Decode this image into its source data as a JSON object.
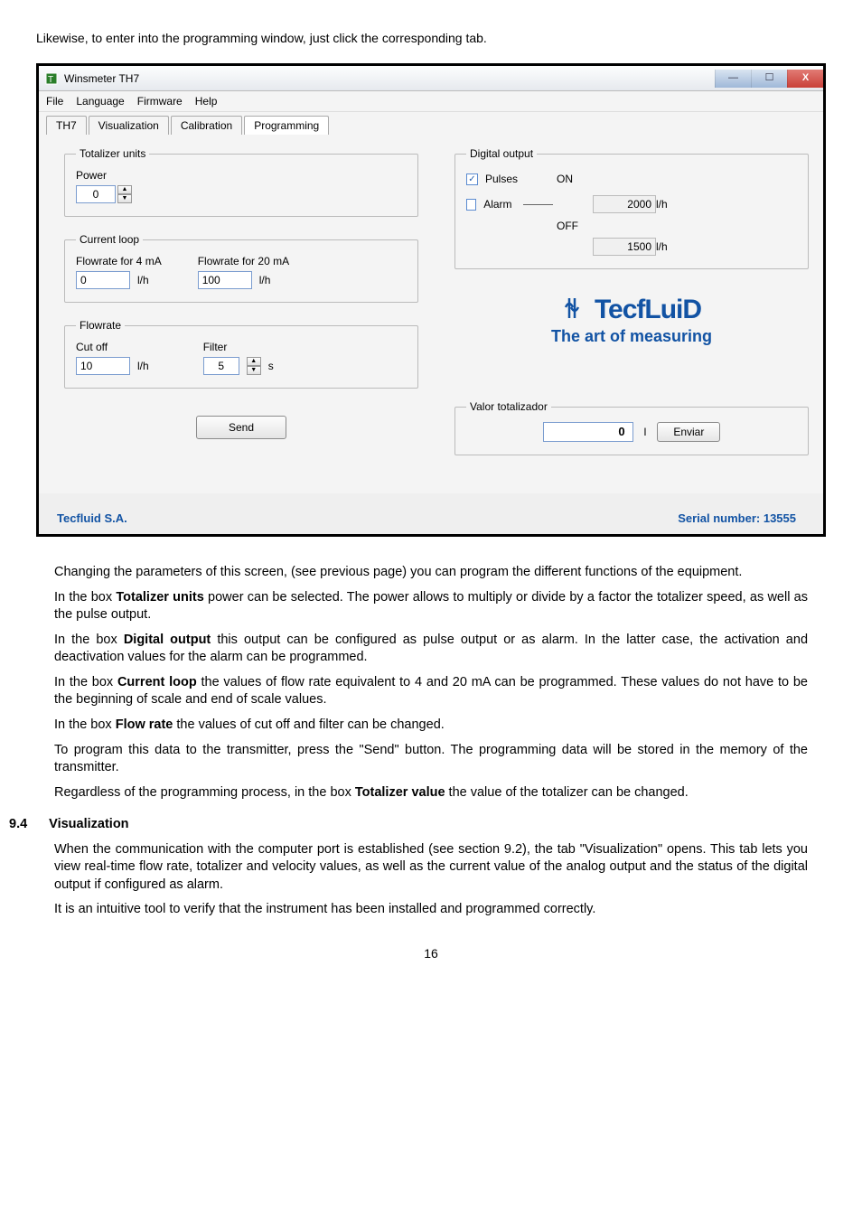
{
  "intro": "Likewise, to enter into the programming window, just click the corresponding tab.",
  "window": {
    "title": "Winsmeter TH7",
    "menu": {
      "file": "File",
      "language": "Language",
      "firmware": "Firmware",
      "help": "Help"
    },
    "tabs": {
      "th7": "TH7",
      "visualization": "Visualization",
      "calibration": "Calibration",
      "programming": "Programming"
    },
    "totalizer": {
      "legend": "Totalizer units",
      "power_label": "Power",
      "power_value": "0"
    },
    "currentloop": {
      "legend": "Current loop",
      "fr4_label": "Flowrate for 4 mA",
      "fr4_value": "0",
      "fr4_unit": "l/h",
      "fr20_label": "Flowrate for 20 mA",
      "fr20_value": "100",
      "fr20_unit": "l/h"
    },
    "flowrate": {
      "legend": "Flowrate",
      "cutoff_label": "Cut off",
      "cutoff_value": "10",
      "cutoff_unit": "l/h",
      "filter_label": "Filter",
      "filter_value": "5",
      "filter_unit": "s"
    },
    "send_label": "Send",
    "digital_output": {
      "legend": "Digital output",
      "pulses_label": "Pulses",
      "alarm_label": "Alarm",
      "on_label": "ON",
      "on_value": "2000",
      "unit": "l/h",
      "off_label": "OFF",
      "off_value": "1500"
    },
    "brand": {
      "name": "TecfLuiD",
      "tag": "The art of measuring"
    },
    "valor": {
      "legend": "Valor totalizador",
      "value": "0",
      "unit": "l",
      "button": "Enviar"
    },
    "footer": {
      "company": "Tecfluid S.A.",
      "serial": "Serial number: 13555"
    }
  },
  "doc": {
    "p1": "Changing the parameters of this screen, (see previous page) you can program the different functions of the equipment.",
    "p2a": "In the box ",
    "p2b": "Totalizer units",
    "p2c": " power can be selected. The power allows to multiply or divide by a factor the totalizer speed, as well as the pulse output.",
    "p3a": "In the box ",
    "p3b": "Digital output",
    "p3c": " this output can be configured as pulse output or as alarm. In the latter case, the activation and deactivation values for the alarm can be programmed.",
    "p4a": "In the box ",
    "p4b": "Current loop",
    "p4c": " the values of flow rate equivalent to 4 and 20 mA can be programmed. These values do not have to be the beginning of scale and end of scale values.",
    "p5a": "In the box ",
    "p5b": "Flow rate",
    "p5c": " the values of cut off and filter can be changed.",
    "p6": "To program this data to the transmitter, press the \"Send\" button. The programming data will be stored in the memory of the transmitter.",
    "p7a": "Regardless of the programming process, in the box ",
    "p7b": "Totalizer value",
    "p7c": " the value of the totalizer can be changed.",
    "sec_num": "9.4",
    "sec_title": "Visualization",
    "p8": "When the communication with the computer port is established (see section 9.2), the tab \"Visualization\" opens. This tab lets you view real-time flow rate, totalizer and velocity values, as well as the current value of the analog output and the status of the digital output if configured as alarm.",
    "p9": "It is an intuitive tool to verify that the instrument has been installed and programmed correctly.",
    "page": "16"
  }
}
